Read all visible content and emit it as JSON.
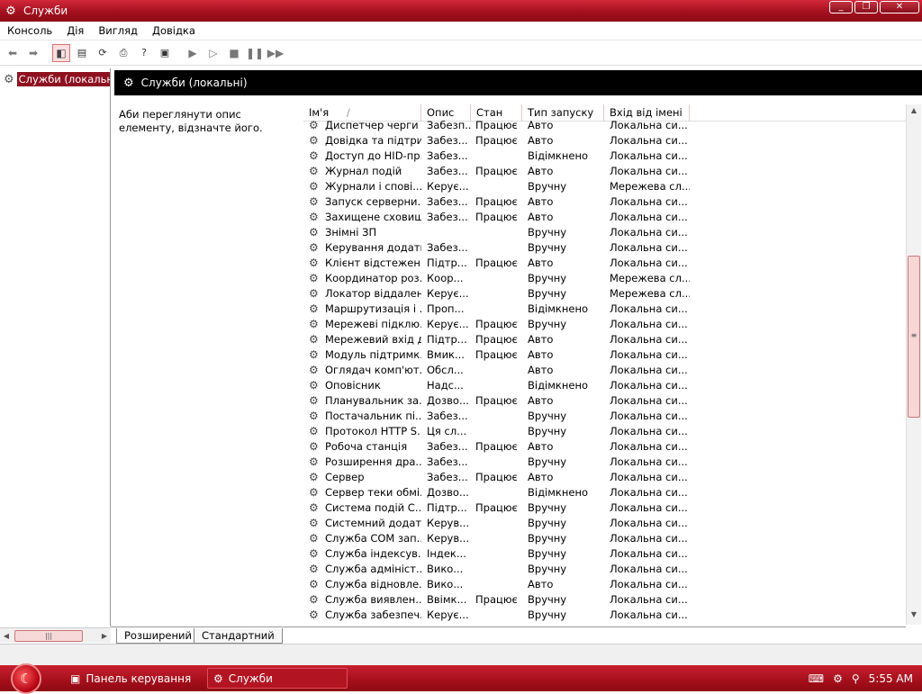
{
  "window": {
    "title": "Служби",
    "btn_min": "_",
    "btn_max": "❐",
    "btn_close": "✕"
  },
  "menu": [
    "Консоль",
    "Дія",
    "Вигляд",
    "Довідка"
  ],
  "tree": {
    "root_label": "Служби (локальні)"
  },
  "header": {
    "title": "Служби (локальні)"
  },
  "description": {
    "text": "Аби переглянути опис елементу, відзначте його."
  },
  "columns": {
    "name": "Ім'я",
    "sort_arrow": "/",
    "desc": "Опис",
    "status": "Стан",
    "startup": "Тип запуску",
    "logon": "Вхід від імені"
  },
  "services": [
    {
      "name": "Диспетчер черги ...",
      "desc": "Забезп...",
      "status": "Працює",
      "startup": "Авто",
      "logon": "Локальна си..."
    },
    {
      "name": "Довідка та підтри...",
      "desc": "Забез...",
      "status": "Працює",
      "startup": "Авто",
      "logon": "Локальна си..."
    },
    {
      "name": "Доступ до HID-пр...",
      "desc": "Забез...",
      "status": "",
      "startup": "Відімкнено",
      "logon": "Локальна си..."
    },
    {
      "name": "Журнал подій",
      "desc": "Забез...",
      "status": "Працює",
      "startup": "Авто",
      "logon": "Локальна си..."
    },
    {
      "name": "Журнали і спові...",
      "desc": "Керує...",
      "status": "",
      "startup": "Вручну",
      "logon": "Мережева сл..."
    },
    {
      "name": "Запуск серверни...",
      "desc": "Забез...",
      "status": "Працює",
      "startup": "Авто",
      "logon": "Локальна си..."
    },
    {
      "name": "Захищене сховище",
      "desc": "Забез...",
      "status": "Працює",
      "startup": "Авто",
      "logon": "Локальна си..."
    },
    {
      "name": "Знімні ЗП",
      "desc": "",
      "status": "",
      "startup": "Вручну",
      "logon": "Локальна си..."
    },
    {
      "name": "Керування додатк...",
      "desc": "Забез...",
      "status": "",
      "startup": "Вручну",
      "logon": "Локальна си..."
    },
    {
      "name": "Клієнт відстежен...",
      "desc": "Підтр...",
      "status": "Працює",
      "startup": "Авто",
      "logon": "Локальна си..."
    },
    {
      "name": "Координатор роз...",
      "desc": "Коор...",
      "status": "",
      "startup": "Вручну",
      "logon": "Мережева сл..."
    },
    {
      "name": "Локатор віддален...",
      "desc": "Керує...",
      "status": "",
      "startup": "Вручну",
      "logon": "Мережева сл..."
    },
    {
      "name": "Маршрутизація і ...",
      "desc": "Проп...",
      "status": "",
      "startup": "Відімкнено",
      "logon": "Локальна си..."
    },
    {
      "name": "Мережеві підклю...",
      "desc": "Керує...",
      "status": "Працює",
      "startup": "Вручну",
      "logon": "Локальна си..."
    },
    {
      "name": "Мережевий вхід д...",
      "desc": "Підтр...",
      "status": "Працює",
      "startup": "Авто",
      "logon": "Локальна си..."
    },
    {
      "name": "Модуль підтримк...",
      "desc": "Вмик...",
      "status": "Працює",
      "startup": "Авто",
      "logon": "Локальна си..."
    },
    {
      "name": "Оглядач комп'ют...",
      "desc": "Обсл...",
      "status": "",
      "startup": "Авто",
      "logon": "Локальна си..."
    },
    {
      "name": "Оповісник",
      "desc": "Надс...",
      "status": "",
      "startup": "Відімкнено",
      "logon": "Локальна си..."
    },
    {
      "name": "Планувальник за...",
      "desc": "Дозво...",
      "status": "Працює",
      "startup": "Авто",
      "logon": "Локальна си..."
    },
    {
      "name": "Постачальник пі...",
      "desc": "Забез...",
      "status": "",
      "startup": "Вручну",
      "logon": "Локальна си..."
    },
    {
      "name": "Протокол HTTP S...",
      "desc": "Ця сл...",
      "status": "",
      "startup": "Вручну",
      "logon": "Локальна си..."
    },
    {
      "name": "Робоча станція",
      "desc": "Забез...",
      "status": "Працює",
      "startup": "Авто",
      "logon": "Локальна си..."
    },
    {
      "name": "Розширення дра...",
      "desc": "Забез...",
      "status": "",
      "startup": "Вручну",
      "logon": "Локальна си..."
    },
    {
      "name": "Сервер",
      "desc": "Забез...",
      "status": "Працює",
      "startup": "Авто",
      "logon": "Локальна си..."
    },
    {
      "name": "Сервер теки обмі...",
      "desc": "Дозво...",
      "status": "",
      "startup": "Відімкнено",
      "logon": "Локальна си..."
    },
    {
      "name": "Система подій С...",
      "desc": "Підтр...",
      "status": "Працює",
      "startup": "Вручну",
      "logon": "Локальна си..."
    },
    {
      "name": "Системний додат...",
      "desc": "Керув...",
      "status": "",
      "startup": "Вручну",
      "logon": "Локальна си..."
    },
    {
      "name": "Служба COM зап...",
      "desc": "Керув...",
      "status": "",
      "startup": "Вручну",
      "logon": "Локальна си..."
    },
    {
      "name": "Служба індексув...",
      "desc": "Індек...",
      "status": "",
      "startup": "Вручну",
      "logon": "Локальна си..."
    },
    {
      "name": "Служба адмініст...",
      "desc": "Вико...",
      "status": "",
      "startup": "Вручну",
      "logon": "Локальна си..."
    },
    {
      "name": "Служба відновле...",
      "desc": "Вико...",
      "status": "",
      "startup": "Авто",
      "logon": "Локальна си..."
    },
    {
      "name": "Служба виявлен...",
      "desc": "Ввімк...",
      "status": "Працює",
      "startup": "Вручну",
      "logon": "Локальна си..."
    },
    {
      "name": "Служба забезпеч...",
      "desc": "Керує...",
      "status": "",
      "startup": "Вручну",
      "logon": "Локальна си..."
    }
  ],
  "tabs": [
    "Розширений",
    "Стандартний"
  ],
  "taskbar": {
    "items": [
      "Панель керування",
      "Служби"
    ],
    "clock": "5:55 AM"
  },
  "colors": {
    "accent": "#a4101e",
    "selection": "#8e1120"
  }
}
